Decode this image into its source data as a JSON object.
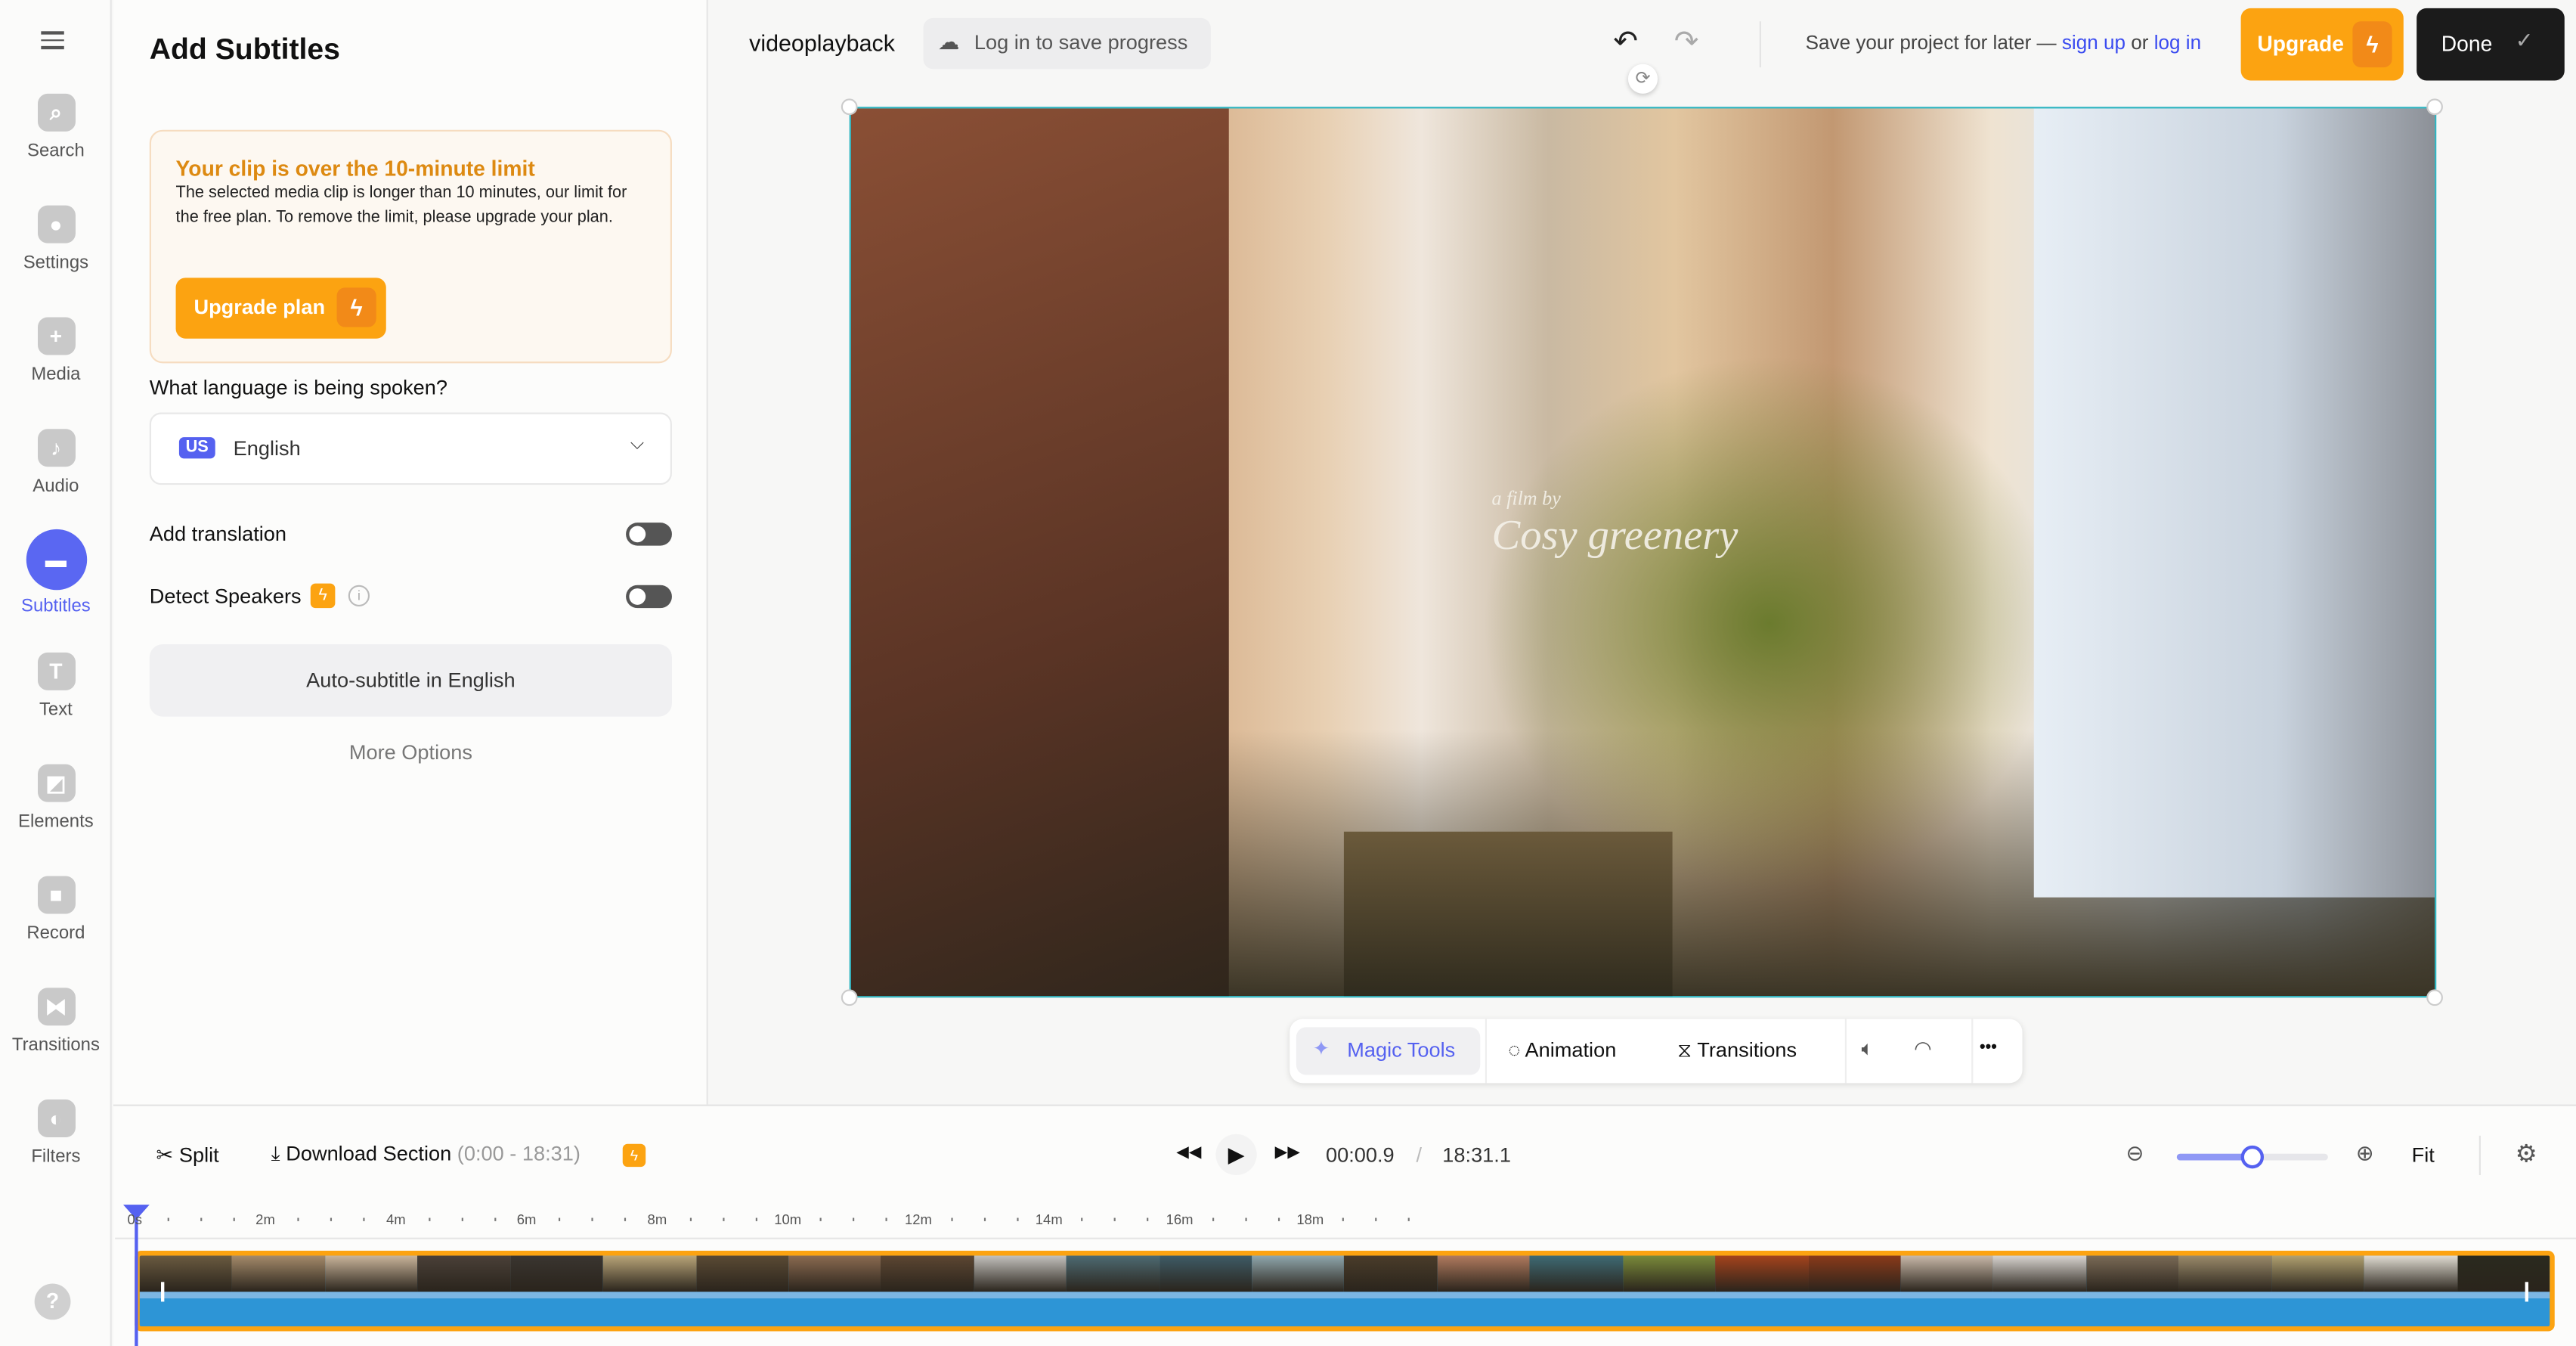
{
  "rail": {
    "items": [
      {
        "label": "Search",
        "icon": "search-icon"
      },
      {
        "label": "Settings",
        "icon": "gear-icon"
      },
      {
        "label": "Media",
        "icon": "plus-icon"
      },
      {
        "label": "Audio",
        "icon": "music-note-icon"
      },
      {
        "label": "Subtitles",
        "icon": "subtitles-icon",
        "active": true
      },
      {
        "label": "Text",
        "icon": "text-icon"
      },
      {
        "label": "Elements",
        "icon": "elements-icon"
      },
      {
        "label": "Record",
        "icon": "record-icon"
      },
      {
        "label": "Transitions",
        "icon": "transitions-icon"
      },
      {
        "label": "Filters",
        "icon": "filters-icon"
      }
    ],
    "help": "?"
  },
  "panel": {
    "title": "Add Subtitles",
    "warning": {
      "title": "Your clip is over the 10-minute limit",
      "body": "The selected media clip is longer than 10 minutes, our limit for the free plan. To remove the limit, please upgrade your plan.",
      "button": "Upgrade plan"
    },
    "language_question": "What language is being spoken?",
    "language": {
      "flag": "US",
      "value": "English"
    },
    "add_translation": {
      "label": "Add translation",
      "on": false
    },
    "detect_speakers": {
      "label": "Detect Speakers",
      "on": false
    },
    "auto_subtitle": "Auto-subtitle in English",
    "more_options": "More Options"
  },
  "topbar": {
    "project_name": "videoplayback",
    "login_save": "Log in to save progress",
    "save_prompt": "Save your project for later —",
    "sign_up": "sign up",
    "or": "or",
    "log_in": "log in",
    "upgrade": "Upgrade",
    "done": "Done"
  },
  "video": {
    "watermark": "a film by Cosy greenery"
  },
  "video_tools": {
    "magic": "Magic Tools",
    "animation": "Animation",
    "transitions": "Transitions",
    "more": "•••"
  },
  "timeline": {
    "split": "Split",
    "download": "Download Section",
    "download_range": "(0:00 - 18:31)",
    "current_time": "00:00.9",
    "separator": "/",
    "duration": "18:31.1",
    "zoom_level": 0.5,
    "fit": "Fit",
    "ruler": [
      "0s",
      "2m",
      "4m",
      "6m",
      "8m",
      "10m",
      "12m",
      "14m",
      "16m",
      "18m"
    ]
  },
  "colors": {
    "accent": "#5561f0",
    "orange": "#fca311",
    "waveform": "#2d95d6"
  }
}
